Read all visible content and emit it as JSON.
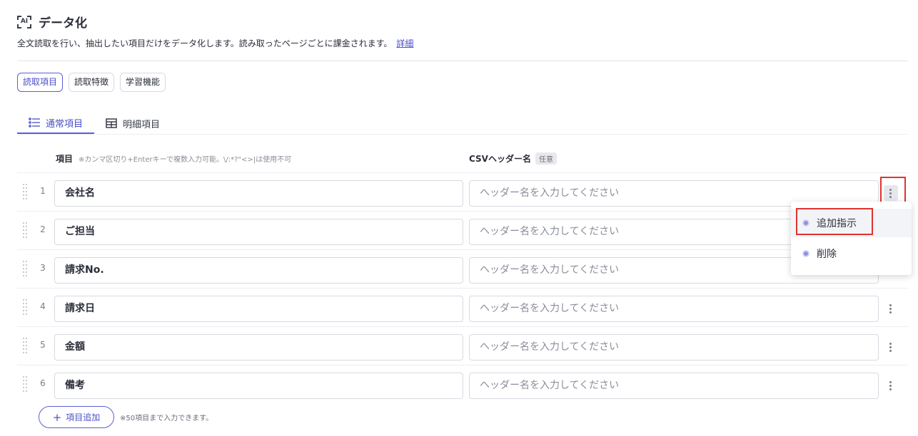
{
  "header": {
    "ai_icon_label": "AI",
    "title": "データ化",
    "description": "全文読取を行い、抽出したい項目だけをデータ化します。読み取ったページごとに課金されます。",
    "detail_link": "詳細"
  },
  "chips": [
    "読取項目",
    "読取特徴",
    "学習機能"
  ],
  "tabs": [
    {
      "label": "通常項目",
      "icon": "list-icon",
      "active": true
    },
    {
      "label": "明細項目",
      "icon": "table-icon",
      "active": false
    }
  ],
  "columns": {
    "item_label": "項目",
    "item_note": "※カンマ区切り+Enterキーで複数入力可能。\\/:*?\"<>|は使用不可",
    "csv_label": "CSVヘッダー名",
    "csv_badge": "任意"
  },
  "rows": [
    {
      "index": "1",
      "item": "会社名",
      "csv_placeholder": "ヘッダー名を入力してください"
    },
    {
      "index": "2",
      "item": "ご担当",
      "csv_placeholder": "ヘッダー名を入力してください"
    },
    {
      "index": "3",
      "item": "請求No.",
      "csv_placeholder": "ヘッダー名を入力してください"
    },
    {
      "index": "4",
      "item": "請求日",
      "csv_placeholder": "ヘッダー名を入力してください"
    },
    {
      "index": "5",
      "item": "金額",
      "csv_placeholder": "ヘッダー名を入力してください"
    },
    {
      "index": "6",
      "item": "備考",
      "csv_placeholder": "ヘッダー名を入力してください"
    }
  ],
  "context_menu": {
    "items": [
      "追加指示",
      "削除"
    ]
  },
  "footer": {
    "add_button": "項目追加",
    "add_plus": "+",
    "add_note": "※50項目まで入力できます。"
  },
  "colors": {
    "accent": "#5b5fd6",
    "highlight_red": "#e0332f"
  }
}
